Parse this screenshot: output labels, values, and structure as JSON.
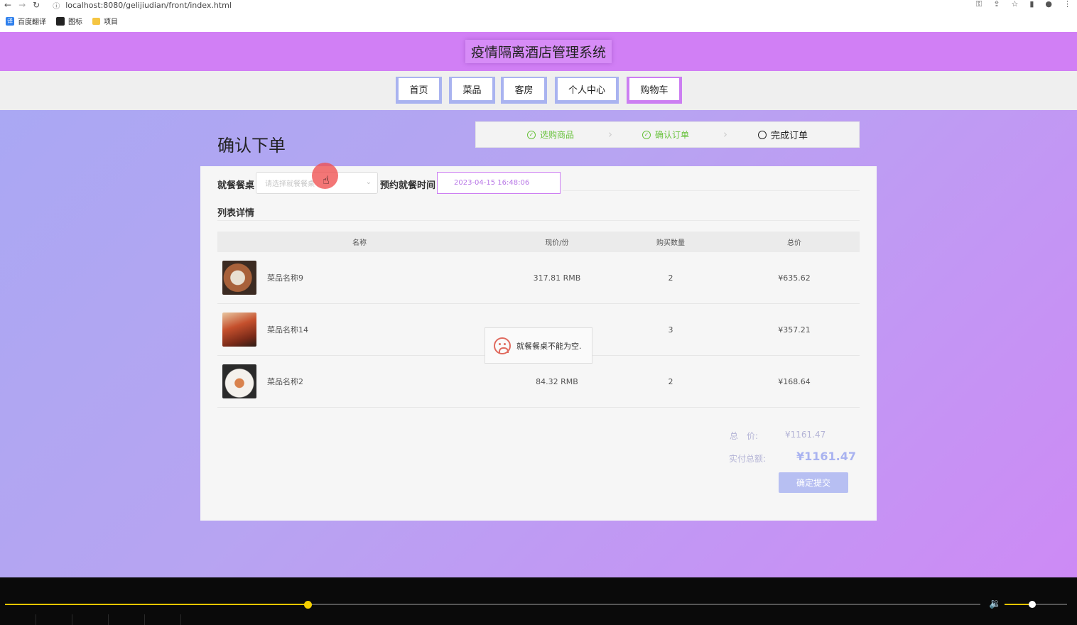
{
  "browser": {
    "url": "localhost:8080/gelijiudian/front/index.html",
    "bookmarks": [
      "百度翻译",
      "图标",
      "项目"
    ],
    "translate_icon_text": "译"
  },
  "site": {
    "title": "疫情隔离酒店管理系统",
    "nav": [
      "首页",
      "菜品",
      "客房",
      "个人中心",
      "购物车"
    ],
    "active_nav": "购物车"
  },
  "checkout": {
    "page_title": "确认下单",
    "steps": [
      "选购商品",
      "确认订单",
      "完成订单"
    ],
    "table_label": "就餐餐桌",
    "table_placeholder": "请选择就餐餐桌",
    "time_label": "预约就餐时间",
    "time_value": "2023-04-15 16:48:06",
    "list_title": "列表详情",
    "columns": [
      "名称",
      "现价/份",
      "购买数量",
      "总价"
    ],
    "items": [
      {
        "name": "菜品名称9",
        "price": "317.81 RMB",
        "qty": "2",
        "total": "¥635.62"
      },
      {
        "name": "菜品名称14",
        "price": "",
        "qty": "3",
        "total": "¥357.21"
      },
      {
        "name": "菜品名称2",
        "price": "84.32 RMB",
        "qty": "2",
        "total": "¥168.64"
      }
    ],
    "total_label": "总　价:",
    "total_value": "¥1161.47",
    "pay_label": "实付总额:",
    "pay_value": "¥1161.47",
    "submit": "确定提交"
  },
  "toast": {
    "message": "就餐餐桌不能为空."
  },
  "colors": {
    "header": "#d17ff5",
    "accent": "#cc7ef2",
    "success": "#67c23a",
    "button": "#b7bff2"
  },
  "player": {
    "progress": 0.31,
    "volume": 0.45
  }
}
